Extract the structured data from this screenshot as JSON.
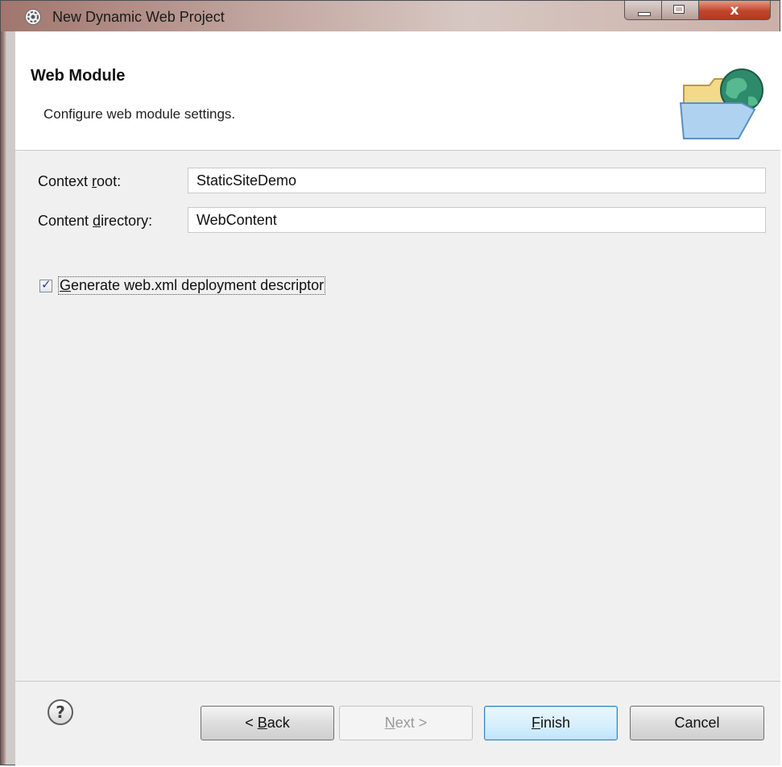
{
  "window": {
    "title": "New Dynamic Web Project",
    "close_glyph": "x"
  },
  "header": {
    "title": "Web Module",
    "subtitle": "Configure web module settings.",
    "icon": "folder-globe-icon"
  },
  "form": {
    "context_root": {
      "label_before": "Context ",
      "label_mnemonic": "r",
      "label_after": "oot:",
      "value": "StaticSiteDemo"
    },
    "content_directory": {
      "label_before": "Content ",
      "label_mnemonic": "d",
      "label_after": "irectory:",
      "value": "WebContent"
    },
    "generate_descriptor": {
      "checked": true,
      "label_mnemonic": "G",
      "label_rest": "enerate web.xml deployment descriptor"
    }
  },
  "footer": {
    "help_glyph": "?",
    "back": {
      "prefix": "< ",
      "mnemonic": "B",
      "rest": "ack"
    },
    "next": {
      "mnemonic": "N",
      "rest": "ext >"
    },
    "finish": {
      "mnemonic": "F",
      "rest": "inish"
    },
    "cancel": {
      "label": "Cancel"
    }
  }
}
